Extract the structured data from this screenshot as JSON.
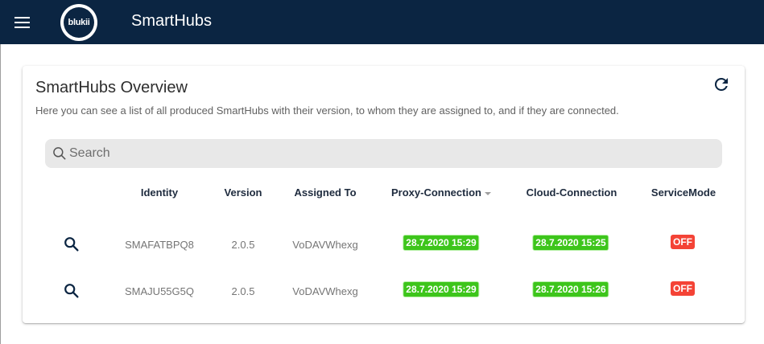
{
  "appbar": {
    "title": "SmartHubs",
    "logo_text": "blukii"
  },
  "card": {
    "title": "SmartHubs Overview",
    "subtitle": "Here you can see a list of all produced SmartHubs with their version, to whom they are assigned to, and if they are connected."
  },
  "search": {
    "placeholder": "Search",
    "value": ""
  },
  "table": {
    "headers": {
      "identity": "Identity",
      "version": "Version",
      "assigned_to": "Assigned To",
      "proxy": "Proxy-Connection",
      "cloud": "Cloud-Connection",
      "service": "ServiceMode"
    },
    "rows": [
      {
        "identity": "SMAFATBPQ8",
        "version": "2.0.5",
        "assigned_to": "VoDAVWhexg",
        "proxy": "28.7.2020 15:29",
        "cloud": "28.7.2020 15:25",
        "service": "OFF"
      },
      {
        "identity": "SMAJU55G5Q",
        "version": "2.0.5",
        "assigned_to": "VoDAVWhexg",
        "proxy": "28.7.2020 15:29",
        "cloud": "28.7.2020 15:26",
        "service": "OFF"
      }
    ]
  },
  "colors": {
    "appbar": "#0b2542",
    "badge_green": "#3dc51b",
    "badge_red": "#f44336"
  },
  "icons": {
    "menu": "menu-icon",
    "refresh": "refresh-icon",
    "search": "search-icon",
    "row_action": "search-icon"
  }
}
